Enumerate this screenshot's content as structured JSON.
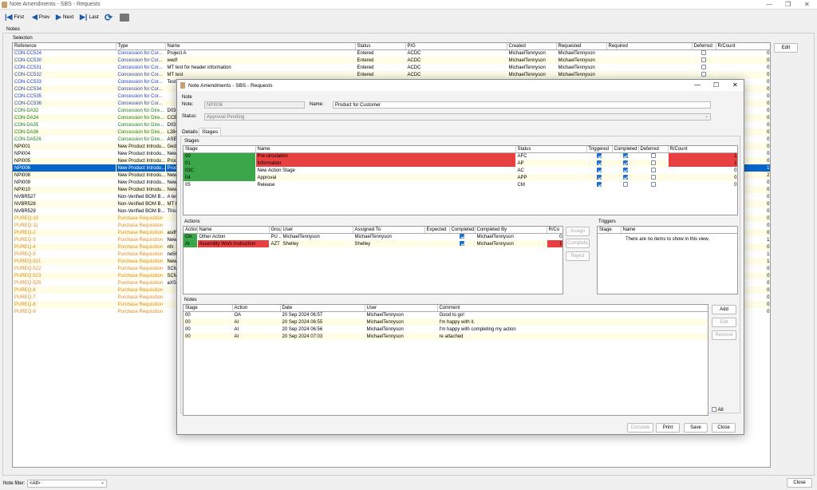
{
  "window": {
    "title": "Note Amendments - SBS - Requests",
    "controls": [
      "—",
      "❐",
      "✕"
    ]
  },
  "toolbar": {
    "first": "First",
    "prev": "Prev",
    "next": "Next",
    "last": "Last"
  },
  "tabs": {
    "notes": "Notes"
  },
  "selection": {
    "group_label": "Selection",
    "edit": "Edit",
    "columns": [
      "Reference",
      "Type",
      "Name",
      "Status",
      "P/G",
      "Created",
      "Requested",
      "Required",
      "Deferred",
      "R/Count"
    ],
    "rows": [
      {
        "ref": "CON-CC524",
        "type": "Concession for Cor...",
        "name": "Project A",
        "status": "Entered",
        "pg": "ACDC",
        "created": "MichaelTennyson",
        "requested": "MichaelTennyson",
        "count": "0",
        "c": "blue"
      },
      {
        "ref": "CON-CC530",
        "type": "Concession for Cor...",
        "name": "wedf",
        "status": "Entered",
        "pg": "ACDC",
        "created": "MichaelTennyson",
        "requested": "MichaelTennyson",
        "count": "0",
        "c": "blue"
      },
      {
        "ref": "CON-CC531",
        "type": "Concession for Cor...",
        "name": "MT test for header information",
        "status": "Entered",
        "pg": "ACDC",
        "created": "MichaelTennyson",
        "requested": "MichaelTennyson",
        "count": "0",
        "c": "blue"
      },
      {
        "ref": "CON-CC532",
        "type": "Concession for Cor...",
        "name": "MT test",
        "status": "Entered",
        "pg": "ACDC",
        "created": "MichaelTennyson",
        "requested": "MichaelTennyson",
        "count": "0",
        "c": "blue"
      },
      {
        "ref": "CON-CC533",
        "type": "Concession for Cor...",
        "name": "Test",
        "status": "",
        "pg": "",
        "created": "",
        "requested": "",
        "count": "0",
        "c": "blue"
      },
      {
        "ref": "CON-CC534",
        "type": "Concession for Cor...",
        "name": "",
        "status": "",
        "pg": "",
        "created": "",
        "requested": "",
        "count": "0",
        "c": "blue"
      },
      {
        "ref": "CON-CC535",
        "type": "Concession for Cor...",
        "name": "",
        "status": "",
        "pg": "",
        "created": "",
        "requested": "",
        "count": "0",
        "c": "blue"
      },
      {
        "ref": "CON-CC536",
        "type": "Concession for Cor...",
        "name": "",
        "status": "",
        "pg": "",
        "created": "",
        "requested": "",
        "count": "0",
        "c": "blue"
      },
      {
        "ref": "CON-DA32",
        "type": "Concession for Dire...",
        "name": "D03",
        "status": "",
        "pg": "",
        "created": "",
        "requested": "",
        "count": "0",
        "c": "green"
      },
      {
        "ref": "CON-DA34",
        "type": "Concession for Dire...",
        "name": "CCB",
        "status": "",
        "pg": "",
        "created": "",
        "requested": "",
        "count": "0",
        "c": "green"
      },
      {
        "ref": "CON-DA35",
        "type": "Concession for Dire...",
        "name": "D03",
        "status": "",
        "pg": "",
        "created": "",
        "requested": "",
        "count": "0",
        "c": "green"
      },
      {
        "ref": "CON-DA36",
        "type": "Concession for Dire...",
        "name": "L284",
        "status": "",
        "pg": "",
        "created": "",
        "requested": "",
        "count": "0",
        "c": "green"
      },
      {
        "ref": "CON-DA526",
        "type": "Concession for Dire...",
        "name": "ASE",
        "status": "",
        "pg": "",
        "created": "",
        "requested": "",
        "count": "0",
        "c": "green"
      },
      {
        "ref": "NPI001",
        "type": "New Product Introdu...",
        "name": "Ged",
        "status": "",
        "pg": "",
        "created": "",
        "requested": "",
        "count": "0",
        "c": ""
      },
      {
        "ref": "NPI004",
        "type": "New Product Introdu...",
        "name": "New",
        "status": "",
        "pg": "",
        "created": "",
        "requested": "",
        "count": "0",
        "c": ""
      },
      {
        "ref": "NPI005",
        "type": "New Product Introdu...",
        "name": "Prod",
        "status": "",
        "pg": "",
        "created": "",
        "requested": "",
        "count": "0",
        "c": ""
      },
      {
        "ref": "NPI006",
        "type": "New Product Introdu...",
        "name": "Prod",
        "status": "",
        "pg": "",
        "created": "",
        "requested": "",
        "count": "1",
        "c": "sel"
      },
      {
        "ref": "NPI008",
        "type": "New Product Introdu...",
        "name": "New",
        "status": "",
        "pg": "",
        "created": "",
        "requested": "",
        "count": "2",
        "c": ""
      },
      {
        "ref": "NPI009",
        "type": "New Product Introdu...",
        "name": "New",
        "status": "",
        "pg": "",
        "created": "",
        "requested": "",
        "count": "0",
        "c": ""
      },
      {
        "ref": "NPI010",
        "type": "New Product Introdu...",
        "name": "New",
        "status": "",
        "pg": "",
        "created": "",
        "requested": "",
        "count": "0",
        "c": ""
      },
      {
        "ref": "NVBR527",
        "type": "Non-Verified BOM B...",
        "name": "A tes",
        "status": "",
        "pg": "",
        "created": "",
        "requested": "",
        "count": "0",
        "c": ""
      },
      {
        "ref": "NVBR528",
        "type": "Non-Verified BOM B...",
        "name": "MT t",
        "status": "",
        "pg": "",
        "created": "",
        "requested": "",
        "count": "0",
        "c": ""
      },
      {
        "ref": "NVBR529",
        "type": "Non-Verified BOM B...",
        "name": "This",
        "status": "",
        "pg": "",
        "created": "",
        "requested": "",
        "count": "0",
        "c": ""
      },
      {
        "ref": "PUREQ-10",
        "type": "Purchase Requisition",
        "name": "",
        "status": "",
        "pg": "",
        "created": "",
        "requested": "",
        "count": "0",
        "c": "orange"
      },
      {
        "ref": "PUREQ-11",
        "type": "Purchase Requisition",
        "name": "",
        "status": "",
        "pg": "",
        "created": "",
        "requested": "",
        "count": "0",
        "c": "orange"
      },
      {
        "ref": "PUREQ-2",
        "type": "Purchase Requisition",
        "name": "asdf",
        "status": "",
        "pg": "",
        "created": "",
        "requested": "",
        "count": "0",
        "c": "orange"
      },
      {
        "ref": "PUREQ-3",
        "type": "Purchase Requisition",
        "name": "New",
        "status": "",
        "pg": "",
        "created": "",
        "requested": "",
        "count": "1",
        "c": "orange"
      },
      {
        "ref": "PUREQ-4",
        "type": "Purchase Requisition",
        "name": "nfx",
        "status": "",
        "pg": "",
        "created": "",
        "requested": "",
        "count": "0",
        "c": "orange"
      },
      {
        "ref": "PUREQ-5",
        "type": "Purchase Requisition",
        "name": "ne56",
        "status": "",
        "pg": "",
        "created": "",
        "requested": "",
        "count": "1",
        "c": "orange"
      },
      {
        "ref": "PUREQ-521",
        "type": "Purchase Requisition",
        "name": "New",
        "status": "",
        "pg": "",
        "created": "",
        "requested": "",
        "count": "1",
        "c": "orange"
      },
      {
        "ref": "PUREQ-522",
        "type": "Purchase Requisition",
        "name": "SCM",
        "status": "",
        "pg": "",
        "created": "",
        "requested": "",
        "count": "0",
        "c": "orange"
      },
      {
        "ref": "PUREQ-523",
        "type": "Purchase Requisition",
        "name": "SCM",
        "status": "",
        "pg": "",
        "created": "",
        "requested": "",
        "count": "0",
        "c": "orange"
      },
      {
        "ref": "PUREQ-525",
        "type": "Purchase Requisition",
        "name": "aXSI",
        "status": "",
        "pg": "",
        "created": "",
        "requested": "",
        "count": "0",
        "c": "orange"
      },
      {
        "ref": "PUREQ-6",
        "type": "Purchase Requisition",
        "name": "",
        "status": "",
        "pg": "",
        "created": "",
        "requested": "",
        "count": "0",
        "c": "orange"
      },
      {
        "ref": "PUREQ-7",
        "type": "Purchase Requisition",
        "name": "",
        "status": "",
        "pg": "",
        "created": "",
        "requested": "",
        "count": "0",
        "c": "orange"
      },
      {
        "ref": "PUREQ-8",
        "type": "Purchase Requisition",
        "name": "",
        "status": "",
        "pg": "",
        "created": "",
        "requested": "",
        "count": "0",
        "c": "orange"
      },
      {
        "ref": "PUREQ-9",
        "type": "Purchase Requisition",
        "name": "",
        "status": "",
        "pg": "",
        "created": "",
        "requested": "",
        "count": "0",
        "c": "orange"
      }
    ]
  },
  "footer": {
    "filter_label": "Note filter:",
    "filter_value": "<All>",
    "close": "Close"
  },
  "dialog": {
    "title": "Note Amendments - SBS - Requests",
    "note_group": "Note",
    "note_label": "Note:",
    "note_value": "NPI006",
    "name_label": "Name:",
    "name_value": "Product for Customer",
    "status_label": "Status:",
    "status_value": "Approval Pending",
    "tab_details": "Details",
    "tab_stages": "Stages",
    "stages": {
      "group": "Stages",
      "columns": [
        "Stage",
        "Name",
        "Status",
        "Triggered",
        "Completed",
        "Deferred",
        "R/Count"
      ],
      "rows": [
        {
          "stage": "00",
          "name": "Pre-circulation",
          "status": "AFC",
          "trig": "on",
          "comp": "on",
          "def": "",
          "count": "1",
          "sc": "grn",
          "nc": "red",
          "rc": "red"
        },
        {
          "stage": "01",
          "name": "Information",
          "status": "AP",
          "trig": "on",
          "comp": "on",
          "def": "",
          "count": "1",
          "sc": "grn",
          "nc": "red",
          "rc": "red"
        },
        {
          "stage": "03C",
          "name": "New Action Stage",
          "status": "AC",
          "trig": "on",
          "comp": "on",
          "def": "",
          "count": "0",
          "sc": "grn",
          "nc": "",
          "rc": ""
        },
        {
          "stage": "04",
          "name": "Approval",
          "status": "APP",
          "trig": "on",
          "comp": "on",
          "def": "",
          "count": "0",
          "sc": "grn",
          "nc": "",
          "rc": ""
        },
        {
          "stage": "05",
          "name": "Release",
          "status": "CM",
          "trig": "on",
          "comp": "",
          "def": "",
          "count": "0",
          "sc": "",
          "nc": "",
          "rc": ""
        }
      ]
    },
    "actions": {
      "group": "Actions",
      "columns": [
        "Action",
        "Name",
        "Group",
        "User",
        "Assigned To",
        "Expected",
        "Completed",
        "Completed By",
        "R/Co"
      ],
      "rows": [
        {
          "action": "OA",
          "name": "Other Action",
          "group": "PU ...",
          "user": "MichaelTennyson",
          "assigned": "MichaelTennyson",
          "expected": "",
          "comp": "on",
          "by": "MichaelTennyson",
          "count": "0",
          "ac": "grn",
          "nc": "",
          "rc": ""
        },
        {
          "action": "AI",
          "name": "Assembly Work Instruction",
          "group": "AZT",
          "user": "Shelley",
          "assigned": "Shelley",
          "expected": "",
          "comp": "on",
          "by": "MichaelTennyson",
          "count": "1",
          "ac": "grn",
          "nc": "red",
          "rc": "red"
        }
      ],
      "assign": "Assign",
      "complete": "Complete",
      "reject": "Reject"
    },
    "triggers": {
      "group": "Triggers",
      "columns": [
        "Stage",
        "Name"
      ],
      "empty": "There are no items to show in this view."
    },
    "notes": {
      "group": "Notes",
      "columns": [
        "Stage",
        "Action",
        "Date",
        "User",
        "Comment"
      ],
      "rows": [
        {
          "stage": "00",
          "action": "OA",
          "date": "20 Sep 2024 06:57",
          "user": "MichaelTennyson",
          "comment": "Good to go!"
        },
        {
          "stage": "00",
          "action": "AI",
          "date": "20 Sep 2024 06:55",
          "user": "MichaelTennyson",
          "comment": "I'm happy with it."
        },
        {
          "stage": "00",
          "action": "AI",
          "date": "20 Sep 2024 06:56",
          "user": "MichaelTennyson",
          "comment": "I'm happy with completing my action"
        },
        {
          "stage": "00",
          "action": "AI",
          "date": "20 Sep 2024 07:03",
          "user": "MichaelTennyson",
          "comment": "re attached"
        }
      ],
      "add": "Add",
      "edit": "Edit",
      "remove": "Remove",
      "all": "All"
    },
    "buttons": {
      "circulate": "Circulate",
      "print": "Print",
      "save": "Save",
      "close": "Close"
    }
  }
}
